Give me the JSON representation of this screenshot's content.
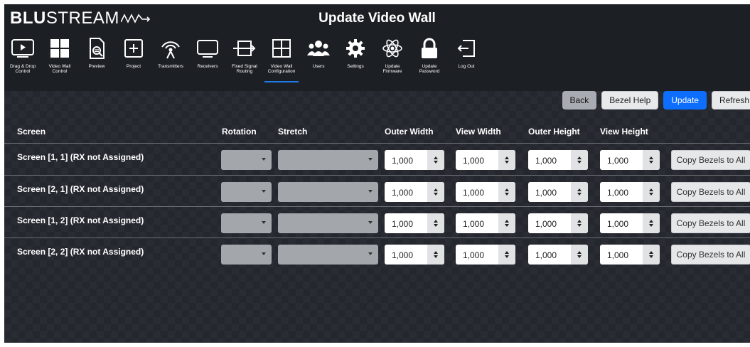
{
  "header": {
    "logo": {
      "bold": "BLU",
      "rest": "STREAM"
    },
    "title": "Update Video Wall"
  },
  "nav": [
    {
      "label": "Drag & Drop\nControl",
      "icon": "monitor-play-icon"
    },
    {
      "label": "Video Wall\nControl",
      "icon": "video-wall-grid-icon"
    },
    {
      "label": "Preview",
      "icon": "preview-magnifier-icon"
    },
    {
      "label": "Project",
      "icon": "project-plus-icon"
    },
    {
      "label": "Transmitters",
      "icon": "transmitter-antenna-icon"
    },
    {
      "label": "Receivers",
      "icon": "receiver-monitor-icon"
    },
    {
      "label": "Fixed Signal\nRouting",
      "icon": "signal-routing-icon"
    },
    {
      "label": "Video Wall\nConfiguration",
      "icon": "video-wall-config-icon",
      "active": true
    },
    {
      "label": "Users",
      "icon": "users-icon"
    },
    {
      "label": "Settings",
      "icon": "settings-gear-icon"
    },
    {
      "label": "Update\nFirmware",
      "icon": "firmware-atom-icon"
    },
    {
      "label": "Update\nPassword",
      "icon": "password-lock-icon"
    },
    {
      "label": "Log Out",
      "icon": "logout-icon"
    }
  ],
  "actions": {
    "back": "Back",
    "bezel_help": "Bezel Help",
    "update": "Update",
    "refresh": "Refresh"
  },
  "columns": {
    "screen": "Screen",
    "rotation": "Rotation",
    "stretch": "Stretch",
    "outer_width": "Outer Width",
    "view_width": "View Width",
    "outer_height": "Outer Height",
    "view_height": "View Height"
  },
  "rows": [
    {
      "screen": "Screen [1, 1] (RX not Assigned)",
      "outer_width": "1,000",
      "view_width": "1,000",
      "outer_height": "1,000",
      "view_height": "1,000",
      "copy": "Copy Bezels to All"
    },
    {
      "screen": "Screen [2, 1] (RX not Assigned)",
      "outer_width": "1,000",
      "view_width": "1,000",
      "outer_height": "1,000",
      "view_height": "1,000",
      "copy": "Copy Bezels to All"
    },
    {
      "screen": "Screen [1, 2] (RX not Assigned)",
      "outer_width": "1,000",
      "view_width": "1,000",
      "outer_height": "1,000",
      "view_height": "1,000",
      "copy": "Copy Bezels to All"
    },
    {
      "screen": "Screen [2, 2] (RX not Assigned)",
      "outer_width": "1,000",
      "view_width": "1,000",
      "outer_height": "1,000",
      "view_height": "1,000",
      "copy": "Copy Bezels to All"
    }
  ],
  "colors": {
    "accent": "#0d6efd",
    "header_bg": "#1c1f24",
    "page_bg": "#24272e"
  }
}
